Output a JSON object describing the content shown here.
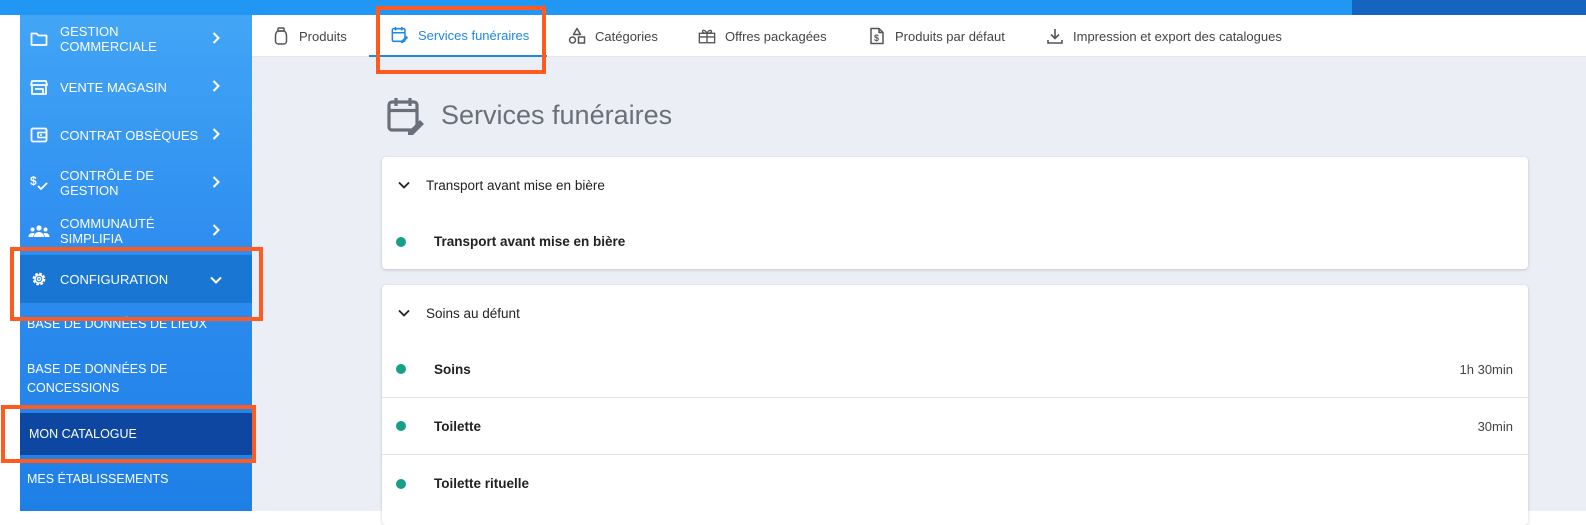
{
  "sidebar": {
    "items": [
      {
        "label": "GESTION COMMERCIALE",
        "icon": "folder-icon",
        "chevron": "right"
      },
      {
        "label": "VENTE MAGASIN",
        "icon": "store-icon",
        "chevron": "right"
      },
      {
        "label": "CONTRAT OBSÈQUES",
        "icon": "wallet-icon",
        "chevron": "right"
      },
      {
        "label": "CONTRÔLE DE GESTION",
        "icon": "dollar-check-icon",
        "chevron": "right"
      },
      {
        "label": "COMMUNAUTÉ SIMPLIFIA",
        "icon": "group-icon",
        "chevron": "right"
      },
      {
        "label": "CONFIGURATION",
        "icon": "gear-icon",
        "chevron": "down"
      }
    ],
    "subitems": [
      {
        "label": "BASE DE DONNÉES DE LIEUX"
      },
      {
        "label": "BASE DE DONNÉES DE CONCESSIONS"
      },
      {
        "label": "MON CATALOGUE"
      },
      {
        "label": "MES ÉTABLISSEMENTS"
      }
    ]
  },
  "tabs": [
    {
      "label": "Produits",
      "icon": "jar-icon"
    },
    {
      "label": "Services funéraires",
      "icon": "calendar-edit-icon"
    },
    {
      "label": "Catégories",
      "icon": "shapes-icon"
    },
    {
      "label": "Offres packagées",
      "icon": "gift-box-icon"
    },
    {
      "label": "Produits par défaut",
      "icon": "dollar-document-icon"
    },
    {
      "label": "Impression et export des catalogues",
      "icon": "download-icon"
    }
  ],
  "page": {
    "title": "Services funéraires"
  },
  "sections": [
    {
      "title": "Transport avant mise en bière",
      "rows": [
        {
          "name": "Transport avant mise en bière",
          "duration": ""
        }
      ]
    },
    {
      "title": "Soins au défunt",
      "rows": [
        {
          "name": "Soins",
          "duration": "1h 30min"
        },
        {
          "name": "Toilette",
          "duration": "30min"
        },
        {
          "name": "Toilette rituelle",
          "duration": ""
        }
      ]
    }
  ],
  "colors": {
    "accent": "#1e88e5",
    "highlight": "#ff5a1f",
    "status_dot": "#16a085",
    "sidebar": "#2f8ef0"
  }
}
